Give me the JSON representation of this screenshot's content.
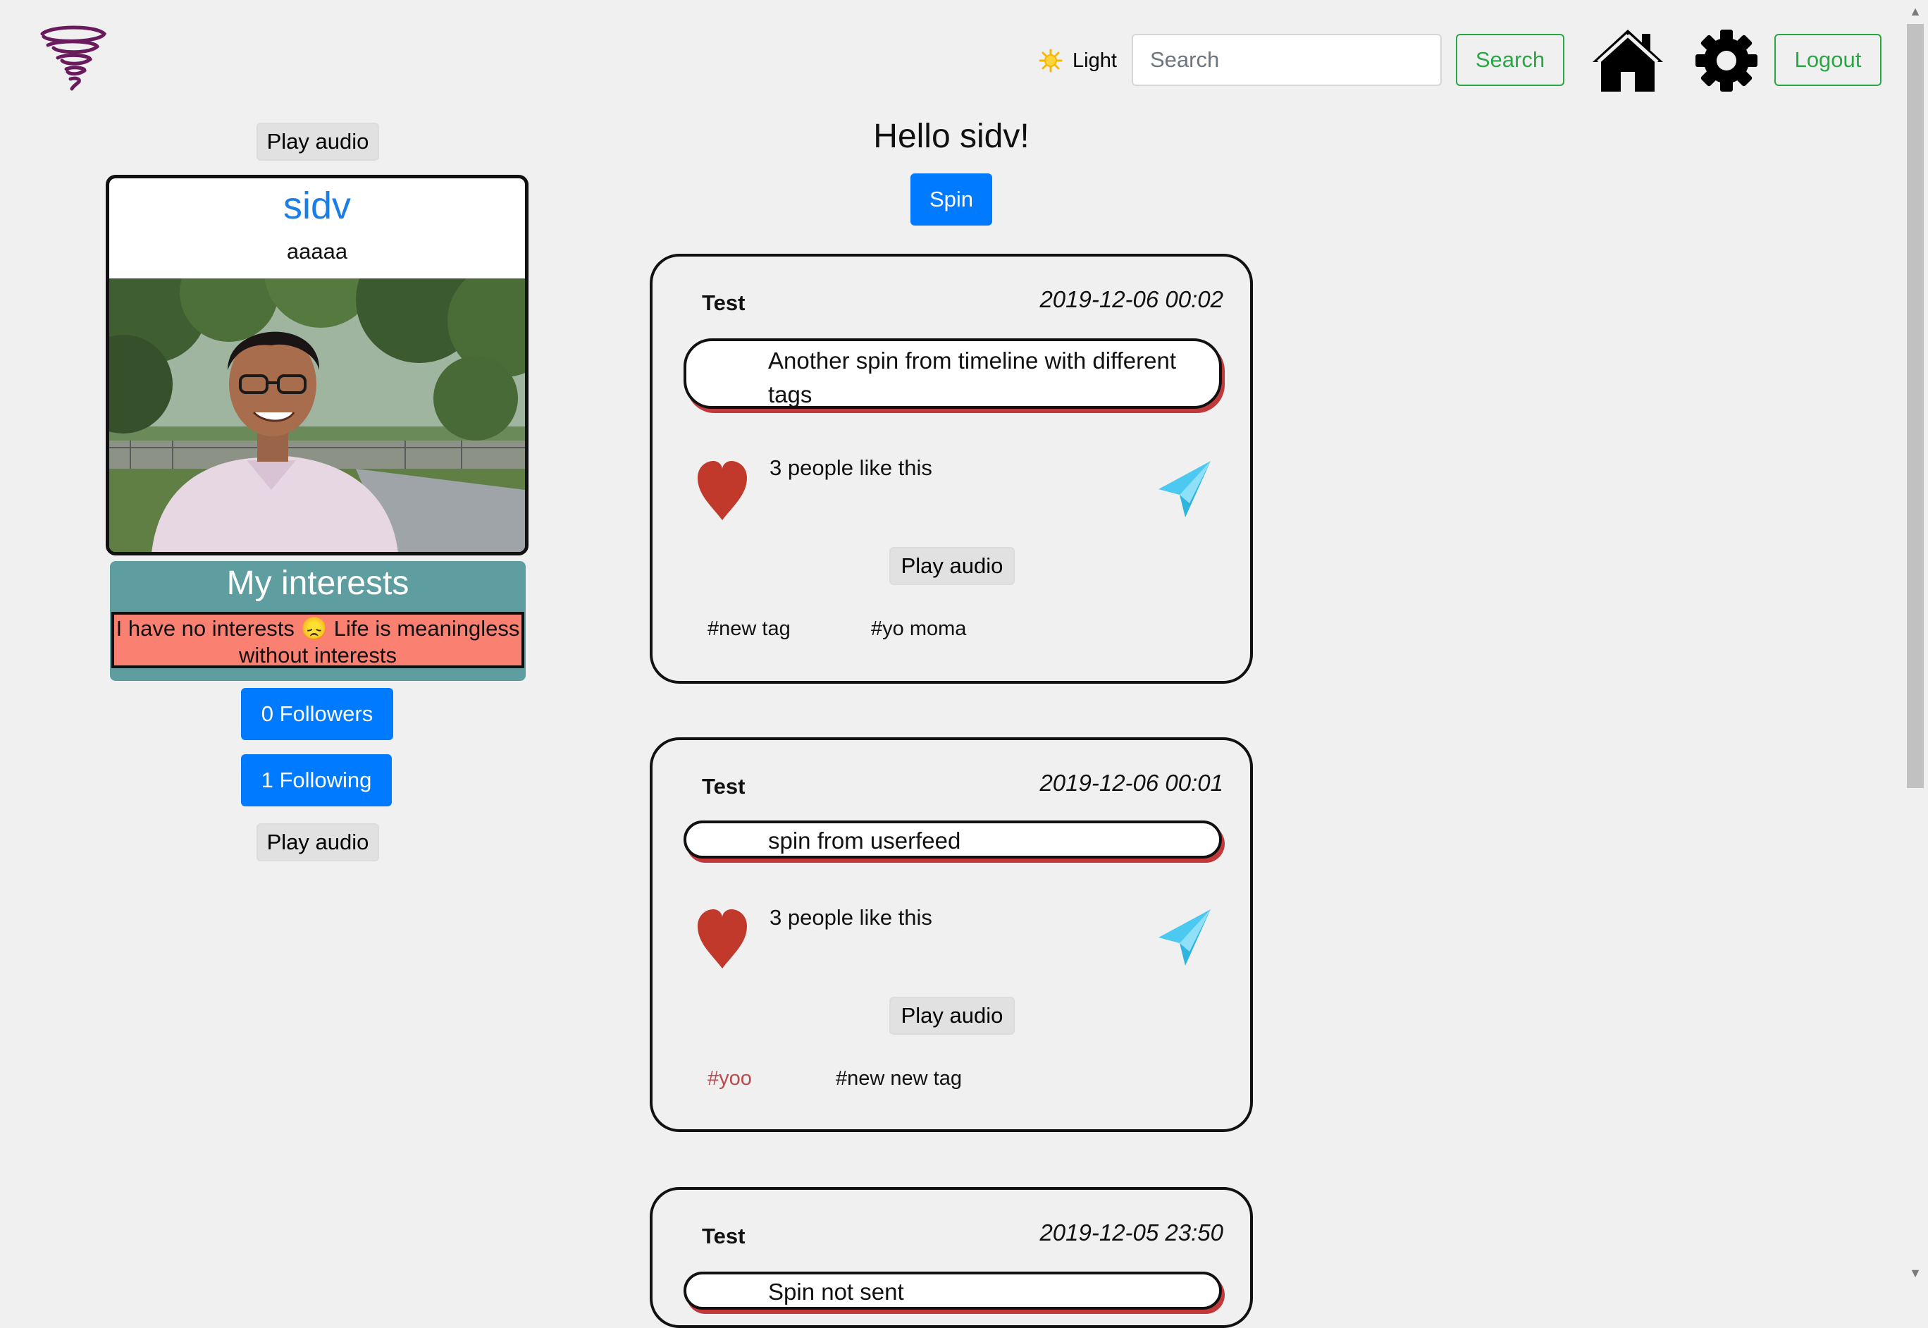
{
  "header": {
    "theme_label": "Light",
    "search_placeholder": "Search",
    "search_button": "Search",
    "logout_button": "Logout",
    "icons": [
      "tornado-logo-icon",
      "sun-icon",
      "home-icon",
      "gear-icon"
    ]
  },
  "profile": {
    "play_audio_top": "Play audio",
    "name": "sidv",
    "bio": "aaaaa",
    "interests_title": "My interests",
    "interests_text": "I have no interests 😞 Life is meaningless without interests",
    "followers_button": "0 Followers",
    "following_button": "1 Following",
    "play_audio_bottom": "Play audio"
  },
  "feed": {
    "greeting": "Hello sidv!",
    "spin_button": "Spin",
    "posts": [
      {
        "author": "Test",
        "date": "2019-12-06 00:02",
        "text": "Another spin from timeline with different tags",
        "likes": "3 people like this",
        "play_audio": "Play audio",
        "tags": [
          "#new tag",
          "#yo moma"
        ]
      },
      {
        "author": "Test",
        "date": "2019-12-06 00:01",
        "text": "spin from userfeed",
        "likes": "3 people like this",
        "play_audio": "Play audio",
        "tags": [
          "#yoo",
          "#new new tag"
        ]
      },
      {
        "author": "Test",
        "date": "2019-12-05 23:50",
        "text": "Spin not sent"
      }
    ]
  },
  "colors": {
    "background": "#f0f0f0",
    "primary": "#007bff",
    "success_outline": "#28a745",
    "interests_header": "#5f9ea0",
    "interests_body": "#fa8072",
    "heart": "#c0392b",
    "plane": "#4cc9f0",
    "name_blue": "#1b7ee6"
  }
}
